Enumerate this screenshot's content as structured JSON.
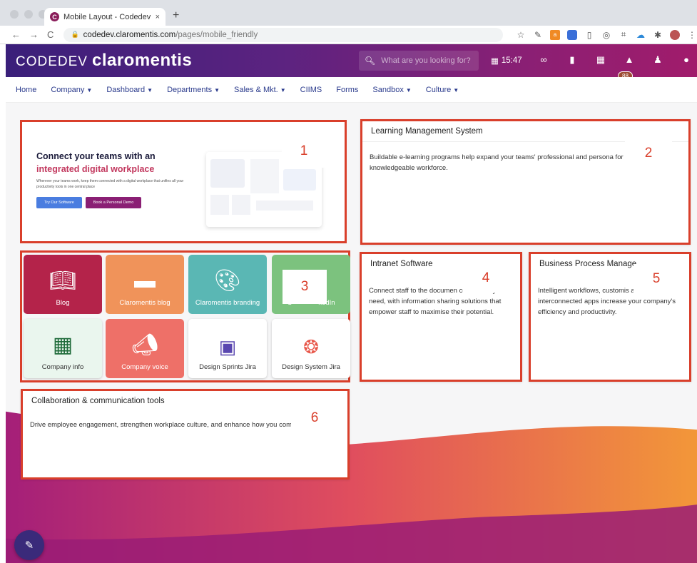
{
  "browser": {
    "tab_title": "Mobile Layout - Codedev Claro",
    "tab_close": "×",
    "new_tab": "+",
    "url_host": "codedev.claromentis.com",
    "url_path": "/pages/mobile_friendly",
    "nav_back": "←",
    "nav_forward": "→",
    "nav_reload": "C"
  },
  "app": {
    "logo_thin": "CODEDEV",
    "logo_bold": "claromentis",
    "search_placeholder": "What are you looking for?",
    "clock": "15:47",
    "notification_count": "88"
  },
  "menu": {
    "items": [
      {
        "label": "Home",
        "dropdown": false
      },
      {
        "label": "Company",
        "dropdown": true
      },
      {
        "label": "Dashboard",
        "dropdown": true
      },
      {
        "label": "Departments",
        "dropdown": true
      },
      {
        "label": "Sales & Mkt.",
        "dropdown": true
      },
      {
        "label": "CIIMS",
        "dropdown": false
      },
      {
        "label": "Forms",
        "dropdown": false
      },
      {
        "label": "Sandbox",
        "dropdown": true
      },
      {
        "label": "Culture",
        "dropdown": true
      }
    ]
  },
  "hero": {
    "number": "1",
    "heading_line1": "Connect your teams with an",
    "heading_line2": "integrated digital workplace",
    "body": "Wherever your teams work, keep them connected with a digital workplace that unifies all your productivity tools in one central place",
    "btn_try": "Try Our Software",
    "btn_demo": "Book a Personal Demo"
  },
  "cards": {
    "lms": {
      "number": "2",
      "title": "Learning Management System",
      "body": "Buildable e-learning programs help expand your teams' professional and persona for a truly knowledgeable workforce."
    },
    "intranet": {
      "number": "4",
      "title": "Intranet Software",
      "body": "Connect staff to the documen content they need, with information sharing solutions that empower staff to maximise their potential."
    },
    "bpm": {
      "number": "5",
      "title": "Business Process Manage",
      "body": "Intelligent workflows, customis and interconnected apps increase your company's efficiency and productivity."
    },
    "collab": {
      "number": "6",
      "title": "Collaboration & communication tools",
      "body": "Drive employee engagement, strengthen workplace culture, and enhance how you communicates."
    }
  },
  "tiles": {
    "number": "3",
    "items": [
      {
        "label": "Blog",
        "color": "#b4234a",
        "icon": "book-open-icon"
      },
      {
        "label": "Claromentis blog",
        "color": "#f0935a",
        "icon": "book-icon"
      },
      {
        "label": "Claromentis branding",
        "color": "#5ab7b4",
        "icon": "palette-icon"
      },
      {
        "label": "C              kedIn",
        "color": "#7cc27e",
        "icon": "linkedin-icon"
      },
      {
        "label": "Company info",
        "color": "#eaf6ee",
        "icon": "building-icon"
      },
      {
        "label": "Company voice",
        "color": "#ee7068",
        "icon": "megaphone-icon"
      },
      {
        "label": "Design Sprints Jira",
        "color": "#ffffff",
        "icon": "presentation-icon"
      },
      {
        "label": "Design System Jira",
        "color": "#ffffff",
        "icon": "circles-icon"
      }
    ]
  },
  "fab": {
    "icon": "pencil-icon",
    "glyph": "✎"
  }
}
